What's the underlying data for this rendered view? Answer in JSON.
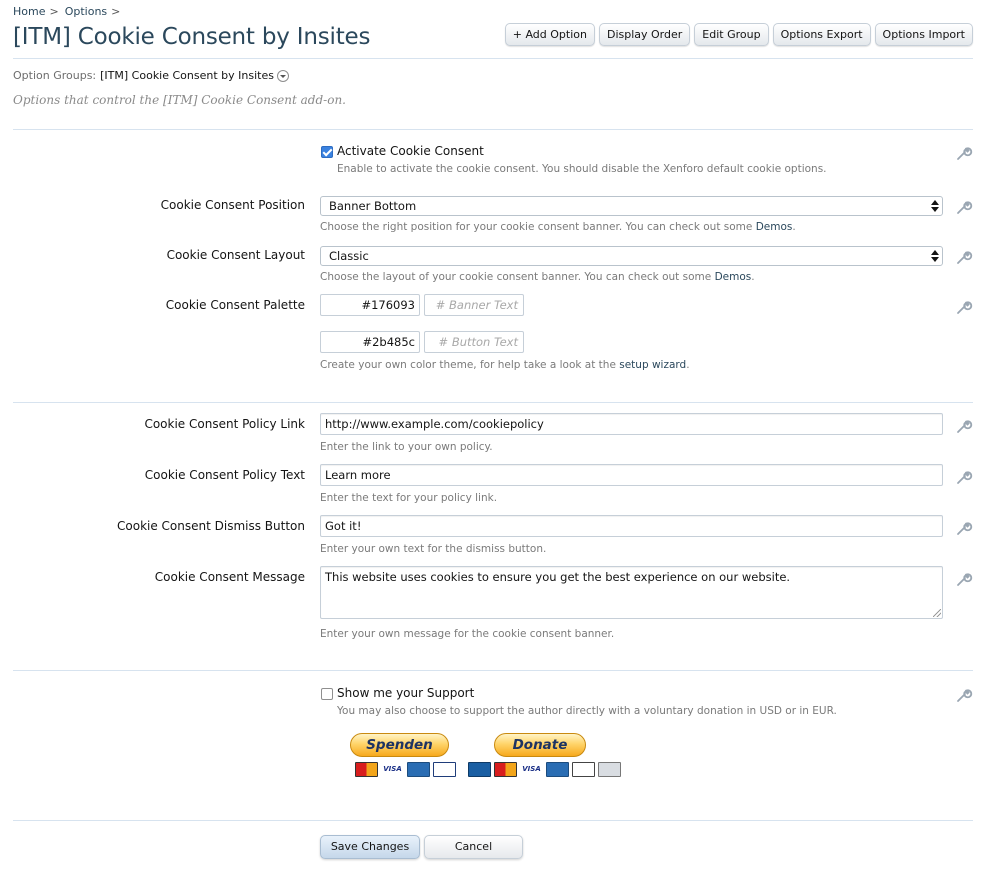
{
  "breadcrumb": {
    "home": "Home",
    "options": "Options",
    "sep": ">"
  },
  "title": "[ITM] Cookie Consent by Insites",
  "toolbar": {
    "add_option": "+ Add Option",
    "display_order": "Display Order",
    "edit_group": "Edit Group",
    "options_export": "Options Export",
    "options_import": "Options Import"
  },
  "option_groups": {
    "label": "Option Groups:",
    "value": "[ITM] Cookie Consent by Insites"
  },
  "description": "Options that control the [ITM] Cookie Consent add-on.",
  "options": {
    "activate": {
      "label": "Activate Cookie Consent",
      "checked": true,
      "hint": "Enable to activate the cookie consent. You should disable the Xenforo default cookie options."
    },
    "position": {
      "label": "Cookie Consent Position",
      "value": "Banner Bottom",
      "hint": "Choose the right position for your cookie consent banner. You can check out some ",
      "hint_link": "Demos",
      "hint_end": "."
    },
    "layout": {
      "label": "Cookie Consent Layout",
      "value": "Classic",
      "hint": "Choose the layout of your cookie consent banner. You can check out some ",
      "hint_link": "Demos",
      "hint_end": "."
    },
    "palette": {
      "label": "Cookie Consent Palette",
      "banner_color": "#176093",
      "banner_text_placeholder": "# Banner Text",
      "button_color": "#2b485c",
      "button_text_placeholder": "# Button Text",
      "hint": "Create your own color theme, for help take a look at the ",
      "hint_link": "setup wizard",
      "hint_end": "."
    },
    "policy_link": {
      "label": "Cookie Consent Policy Link",
      "value": "http://www.example.com/cookiepolicy",
      "hint": "Enter the link to your own policy."
    },
    "policy_text": {
      "label": "Cookie Consent Policy Text",
      "value": "Learn more",
      "hint": "Enter the text for your policy link."
    },
    "dismiss": {
      "label": "Cookie Consent Dismiss Button",
      "value": "Got it!",
      "hint": "Enter your own text for the dismiss button."
    },
    "message": {
      "label": "Cookie Consent Message",
      "value": "This website uses cookies to ensure you get the best experience on our website.",
      "hint": "Enter your own message for the cookie consent banner."
    },
    "support": {
      "label": "Show me your Support",
      "checked": false,
      "hint": "You may also choose to support the author directly with a voluntary donation in USD or in EUR."
    }
  },
  "donate": {
    "eur_label": "Spenden",
    "usd_label": "Donate",
    "eur_cards": [
      "Mastercard",
      "VISA",
      "American Express",
      "EC"
    ],
    "usd_cards": [
      "Maestro",
      "Mastercard",
      "VISA",
      "American Express",
      "Discover",
      "Bank"
    ]
  },
  "buttons": {
    "save": "Save Changes",
    "cancel": "Cancel"
  },
  "colors": {
    "link": "#2b485c",
    "accent": "#3a82e0",
    "divider": "#d7e3ef"
  }
}
